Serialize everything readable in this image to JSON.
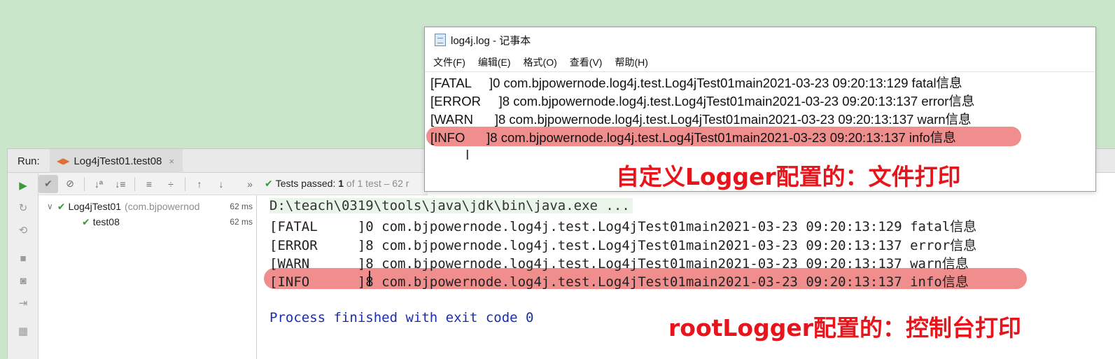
{
  "ide": {
    "run_label": "Run:",
    "tab_title": "Log4jTest01.test08",
    "tab_close": "×",
    "toolbar": {
      "status_prefix": "Tests passed:",
      "status_count": "1",
      "status_rest": "of 1 test – 62 r"
    },
    "tree": {
      "root": {
        "name": "Log4jTest01",
        "package": "(com.bjpowernod",
        "duration": "62 ms"
      },
      "child": {
        "name": "test08",
        "duration": "62 ms"
      }
    },
    "console": {
      "command": "D:\\teach\\0319\\tools\\java\\jdk\\bin\\java.exe ...",
      "lines": [
        "[FATAL     ]0 com.bjpowernode.log4j.test.Log4jTest01main2021-03-23 09:20:13:129 fatal信息",
        "[ERROR     ]8 com.bjpowernode.log4j.test.Log4jTest01main2021-03-23 09:20:13:137 error信息",
        "[WARN      ]8 com.bjpowernode.log4j.test.Log4jTest01main2021-03-23 09:20:13:137 warn信息",
        "[INFO      ]8 com.bjpowernode.log4j.test.Log4jTest01main2021-03-23 09:20:13:137 info信息"
      ],
      "exit_message": "Process finished with exit code 0"
    }
  },
  "notepad": {
    "title": "log4j.log - 记事本",
    "menu": [
      "文件(F)",
      "编辑(E)",
      "格式(O)",
      "查看(V)",
      "帮助(H)"
    ],
    "lines": [
      "[FATAL     ]0 com.bjpowernode.log4j.test.Log4jTest01main2021-03-23 09:20:13:129 fatal信息",
      "[ERROR     ]8 com.bjpowernode.log4j.test.Log4jTest01main2021-03-23 09:20:13:137 error信息",
      "[WARN      ]8 com.bjpowernode.log4j.test.Log4jTest01main2021-03-23 09:20:13:137 warn信息",
      "[INFO      ]8 com.bjpowernode.log4j.test.Log4jTest01main2021-03-23 09:20:13:137 info信息"
    ],
    "cursor_glyph": "I"
  },
  "annotations": {
    "file_label": "自定义Logger配置的：文件打印",
    "console_label": "rootLogger配置的：控制台打印"
  },
  "colors": {
    "background": "#c9e6cb",
    "highlight": "#f08e8e",
    "annotation": "#e8141b",
    "success": "#3a9a3a",
    "exit_text": "#1b2ea8"
  }
}
